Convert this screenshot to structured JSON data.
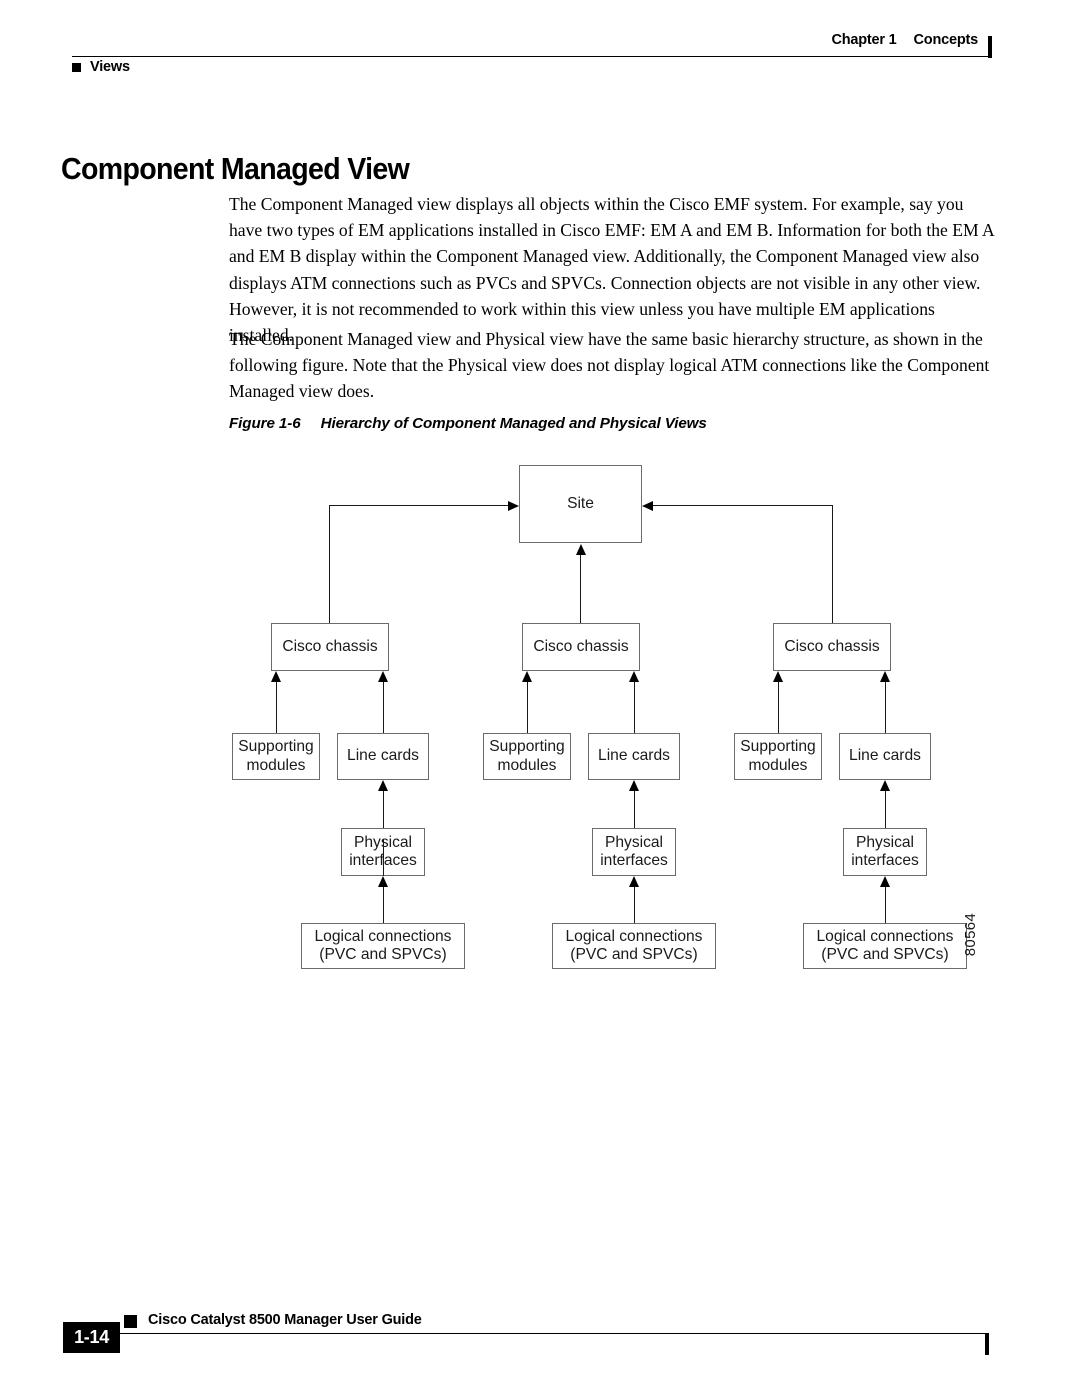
{
  "header": {
    "chapter": "Chapter 1",
    "chapter_title": "Concepts",
    "breadcrumb": "Views"
  },
  "title": "Component Managed View",
  "paragraphs": [
    "The Component Managed view displays all objects within the Cisco EMF system. For example, say you have two types of EM applications installed in Cisco EMF: EM A and EM B. Information for both the EM A and EM B display within the Component Managed view. Additionally, the Component Managed view also displays ATM connections such as PVCs and SPVCs. Connection objects are not visible in any other view. However, it is not recommended to work within this view unless you have multiple EM applications installed.",
    "The Component Managed view and Physical view have the same basic hierarchy structure, as shown in the following figure. Note that the Physical view does not display logical ATM connections like the Component Managed view does."
  ],
  "figure": {
    "number": "Figure 1-6",
    "caption": "Hierarchy of Component Managed and Physical Views",
    "art_id": "80564",
    "nodes": {
      "site": "Site",
      "chassis": "Cisco chassis",
      "supporting_modules": "Supporting\nmodules",
      "line_cards": "Line cards",
      "physical_interfaces": "Physical\ninterfaces",
      "logical_connections": "Logical connections\n(PVC and SPVCs)"
    }
  },
  "footer": {
    "page_number": "1-14",
    "guide_title": "Cisco Catalyst 8500 Manager User Guide"
  }
}
